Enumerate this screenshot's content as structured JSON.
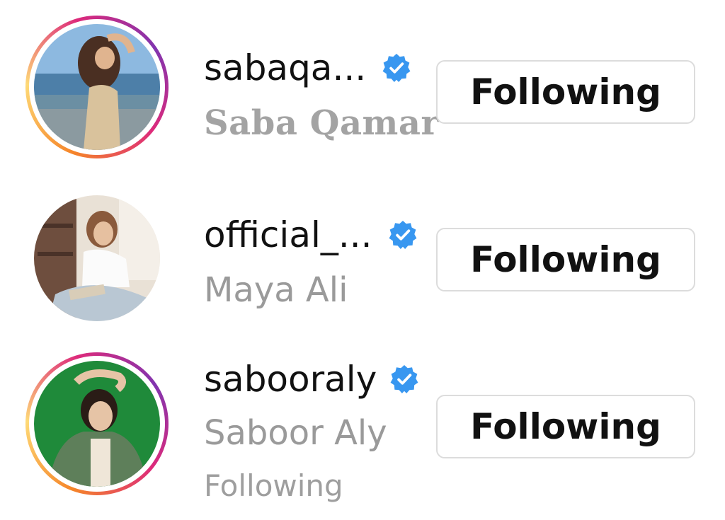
{
  "accounts": [
    {
      "username": "sabaqa...",
      "full_name": "Saba Qamar",
      "verified": true,
      "has_story_ring": true,
      "button_label": "Following",
      "mutual_text": ""
    },
    {
      "username": "official_...",
      "full_name": "Maya Ali",
      "verified": true,
      "has_story_ring": false,
      "button_label": "Following",
      "mutual_text": ""
    },
    {
      "username": "sabooraly",
      "full_name": "Saboor Aly",
      "verified": true,
      "has_story_ring": true,
      "button_label": "Following",
      "mutual_text": "Following"
    }
  ],
  "colors": {
    "verified_badge": "#3897f0",
    "secondary_text": "#9a9a9a",
    "primary_text": "#111111",
    "button_border": "#dcdcdc"
  },
  "icons": {
    "verified": "verified-badge-icon",
    "avatar": "profile-photo"
  }
}
